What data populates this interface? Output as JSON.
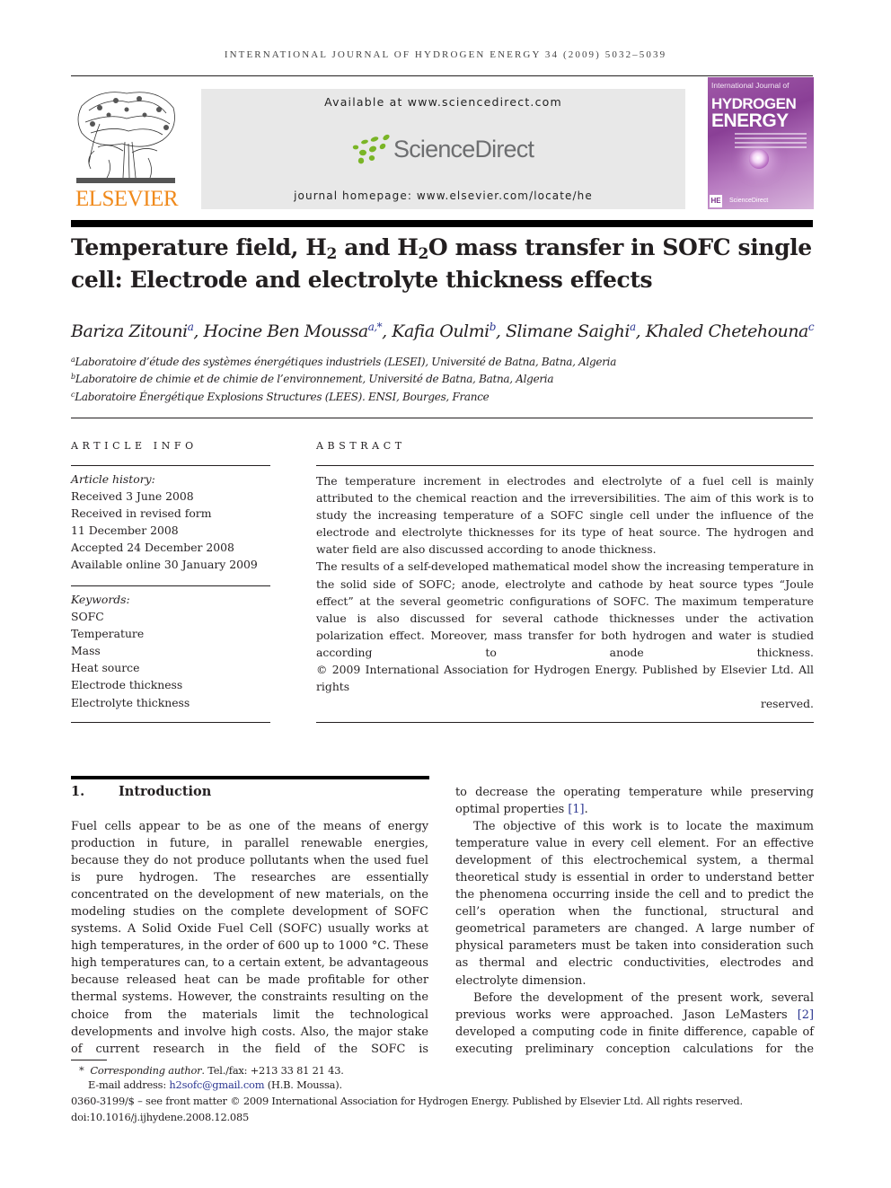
{
  "running_head": "INTERNATIONAL JOURNAL OF HYDROGEN ENERGY 34 (2009) 5032–5039",
  "masthead": {
    "publisher_logo": "ELSEVIER",
    "available_at": "Available at www.sciencedirect.com",
    "sciencedirect_logo": "ScienceDirect",
    "journal_homepage": "journal homepage: www.elsevier.com/locate/he",
    "cover": {
      "line1": "International Journal of",
      "line2": "HYDROGEN",
      "line3": "ENERGY",
      "badge": "HE",
      "footer": "ScienceDirect"
    },
    "colors": {
      "elsevier_orange": "#f08a1c",
      "sciencedirect_green": "#7ab526",
      "sciencedirect_grey": "#6d6e70",
      "cover_purple": "#8a3f96",
      "link_blue": "#2a3590"
    }
  },
  "article": {
    "title_parts": {
      "p1": "Temperature field, H",
      "sub1": "2",
      "p2": " and H",
      "sub2": "2",
      "p3": "O mass transfer in SOFC single",
      "line2": "cell: Electrode and electrolyte thickness effects"
    },
    "authors": [
      {
        "name": "Bariza Zitouni",
        "sup": "a",
        "sep": ", "
      },
      {
        "name": "Hocine Ben Moussa",
        "sup": "a,*",
        "sep": ", "
      },
      {
        "name": "Kafia Oulmi",
        "sup": "b",
        "sep": ", "
      },
      {
        "name": "Slimane Saighi",
        "sup": "a",
        "sep": ", "
      },
      {
        "name": "Khaled Chetehouna",
        "sup": "c",
        "sep": ""
      }
    ],
    "affiliations": [
      {
        "mark": "a",
        "text": "Laboratoire d’étude des systèmes énergétiques industriels (LESEI), Université de Batna, Batna, Algeria"
      },
      {
        "mark": "b",
        "text": "Laboratoire de chimie et de chimie de l’environnement, Université de Batna, Batna, Algeria"
      },
      {
        "mark": "c",
        "text": "Laboratoire Énergétique Explosions Structures (LEES). ENSI, Bourges, France"
      }
    ]
  },
  "article_info": {
    "heading": "ARTICLE INFO",
    "history_label": "Article history:",
    "history": [
      "Received 3 June 2008",
      "Received in revised form",
      "11 December 2008",
      "Accepted 24 December 2008",
      "Available online 30 January 2009"
    ],
    "keywords_label": "Keywords:",
    "keywords": [
      "SOFC",
      "Temperature",
      "Mass",
      "Heat source",
      "Electrode thickness",
      "Electrolyte thickness"
    ]
  },
  "abstract": {
    "heading": "ABSTRACT",
    "paragraphs": [
      "The temperature increment in electrodes and electrolyte of a fuel cell is mainly attributed to the chemical reaction and the irreversibilities. The aim of this work is to study the increasing temperature of a SOFC single cell under the influence of the electrode and electrolyte thicknesses for its type of heat source. The hydrogen and water field are also discussed according to anode thickness.",
      "The results of a self-developed mathematical model show the increasing temperature in the solid side of SOFC; anode, electrolyte and cathode by heat source types “Joule effect” at the several geometric configurations of SOFC. The maximum temperature value is also discussed for several cathode thicknesses under the activation polarization effect. Moreover, mass transfer for both hydrogen and water is studied according to anode thickness.",
      "© 2009 International Association for Hydrogen Energy. Published by Elsevier Ltd. All rights"
    ],
    "last_line": "reserved."
  },
  "introduction": {
    "number": "1.",
    "heading": "Introduction",
    "left_column": "Fuel cells appear to be as one of the means of energy production in future, in parallel renewable energies, because they do not produce pollutants when the used fuel is pure hydrogen. The researches are essentially concentrated on the development of new materials, on the modeling studies on the complete development of SOFC systems. A Solid Oxide Fuel Cell (SOFC) usually works at high temperatures, in the order of 600 up to 1000 °C. These high temperatures can, to a certain extent, be advantageous because released heat can be made profitable for other thermal systems. However, the constraints resulting on the choice from the materials limit the technological developments and involve high costs. Also, the major stake of current research in the field of the SOFC is",
    "right_column": {
      "p1_text": "to decrease the operating temperature while preserving optimal properties ",
      "p1_ref": "[1]",
      "p1_end": ".",
      "p2": "The objective of this work is to locate the maximum temperature value in every cell element. For an effective development of this electrochemical system, a thermal theoretical study is essential in order to understand better the phenomena occurring inside the cell and to predict the cell’s operation when the functional, structural and geometrical parameters are changed. A large number of physical parameters must be taken into consideration such as thermal and electric conductivities, electrodes and electrolyte dimension.",
      "p3_text": "Before the development of the present work, several previous works were approached. Jason LeMasters ",
      "p3_ref": "[2]",
      "p3_end": " developed a computing code in finite difference, capable of executing preliminary conception calculations for the"
    }
  },
  "footnotes": {
    "star": "*",
    "corresponding_label": "Corresponding author",
    "corresponding_rest": ". Tel./fax: +213 33 81 21 43.",
    "email_label": "E-mail address: ",
    "email": "h2sofc@gmail.com",
    "email_after": " (H.B. Moussa).",
    "issn_line": "0360-3199/$ – see front matter © 2009 International Association for Hydrogen Energy. Published by Elsevier Ltd. All rights reserved.",
    "doi": "doi:10.1016/j.ijhydene.2008.12.085"
  }
}
